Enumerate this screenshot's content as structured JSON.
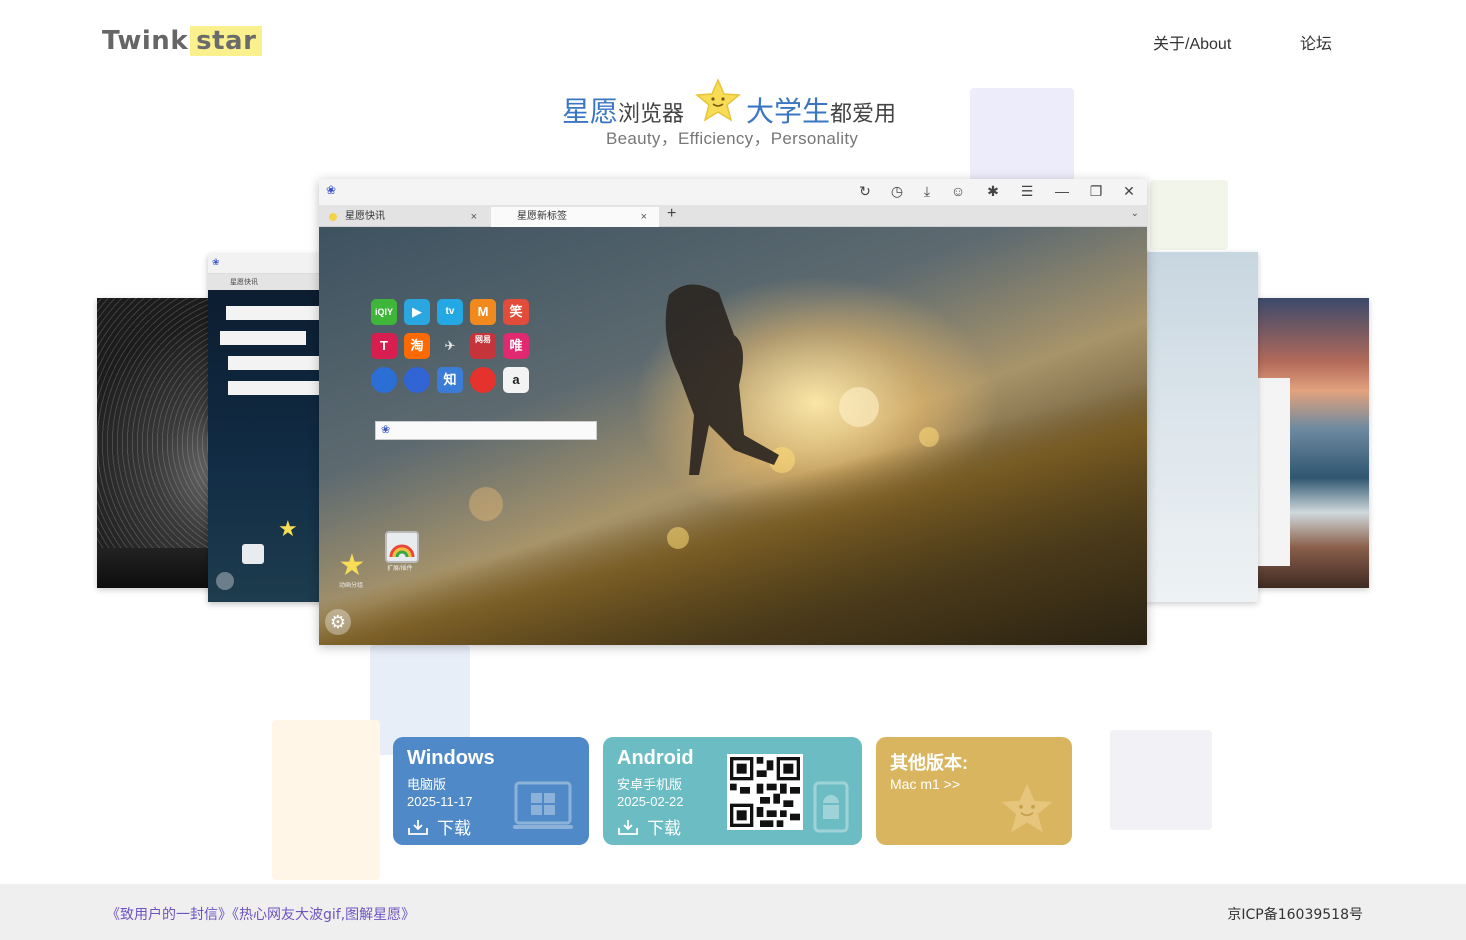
{
  "header": {
    "logo_part1": "Twink",
    "logo_part2": "star",
    "nav": [
      {
        "label": "关于/About"
      },
      {
        "label": "论坛"
      }
    ]
  },
  "hero": {
    "title_part1": "星愿",
    "title_part2": "浏览器",
    "title_part3": "大学生",
    "title_part4": "都爱用",
    "subtitle": "Beauty，Efficiency，Personality"
  },
  "preview": {
    "tabs": [
      {
        "label": "星愿快讯",
        "close": "×"
      },
      {
        "label": "星愿新标签",
        "close": "×"
      }
    ],
    "new_tab": "+",
    "side_tab": "星愿快讯",
    "titlebar_icons": [
      "refresh-icon",
      "history-icon",
      "download-icon",
      "account-icon",
      "extension-icon",
      "menu-icon",
      "minimize-icon",
      "restore-icon",
      "close-icon"
    ],
    "widgets": [
      {
        "label": "动画分组"
      },
      {
        "label": "扩展/插件"
      }
    ],
    "apps": [
      "iQIY",
      "▶",
      "tv",
      "M",
      "笑",
      "T",
      "淘",
      "✈",
      "网易",
      "唯",
      "",
      "",
      "知",
      "",
      "a"
    ]
  },
  "downloads": [
    {
      "name": "Windows",
      "version": "电脑版",
      "date": "2025-11-17",
      "action": "下载",
      "color": "#5089c7"
    },
    {
      "name": "Android",
      "version": "安卓手机版",
      "date": "2025-02-22",
      "action": "下载",
      "color": "#6cbcc3"
    },
    {
      "name": "其他版本:",
      "version": "Mac m1 >>",
      "color": "#d9b55f"
    }
  ],
  "footer": {
    "links_text": "《致用户的一封信》《热心网友大波gif,图解星愿》",
    "icp": "京ICP备16039518号"
  }
}
